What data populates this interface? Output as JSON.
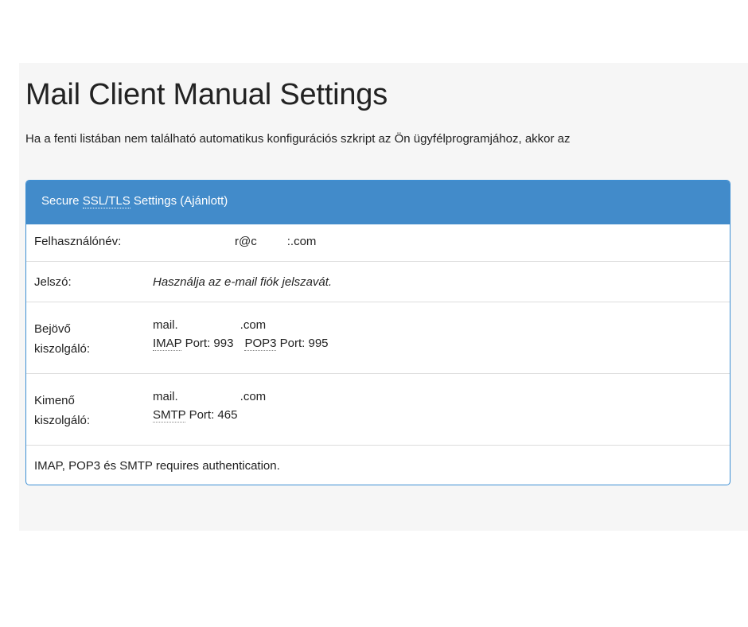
{
  "page": {
    "title": "Mail Client Manual Settings",
    "intro": "Ha a fenti listában nem található automatikus konfigurációs szkript az Ön ügyfélprogramjához, akkor az"
  },
  "panel": {
    "heading_prefix": "Secure ",
    "heading_abbr": "SSL/TLS",
    "heading_suffix": " Settings (Ajánlott)",
    "username": {
      "label": "Felhasználónév:",
      "value_start": "r@c",
      "value_end": ":.com"
    },
    "password": {
      "label": "Jelszó:",
      "value": "Használja az e-mail fiók jelszavát."
    },
    "incoming": {
      "label_line1": "Bejövő",
      "label_line2": "kiszolgáló:",
      "host_start": "mail.",
      "host_end": ".com",
      "imap_abbr": "IMAP",
      "imap_port": " Port: 993",
      "pop3_abbr": "POP3",
      "pop3_port": " Port: 995"
    },
    "outgoing": {
      "label_line1": "Kimenő",
      "label_line2": "kiszolgáló:",
      "host_start": "mail.",
      "host_end": ".com",
      "smtp_abbr": "SMTP",
      "smtp_port": " Port: 465"
    },
    "note": "IMAP, POP3 és SMTP requires authentication."
  },
  "colors": {
    "panel_header_bg": "#428bca",
    "panel_border": "#3d8fd4",
    "page_bg": "#f6f6f6"
  }
}
